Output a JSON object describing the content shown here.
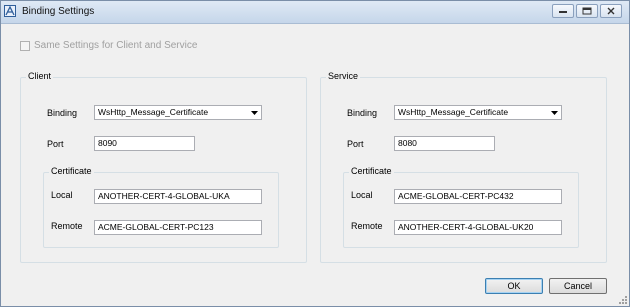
{
  "window": {
    "title": "Binding Settings"
  },
  "same_settings": {
    "label": "Same Settings for Client and Service",
    "checked": false,
    "enabled": false
  },
  "client": {
    "group_title": "Client",
    "binding_label": "Binding",
    "binding_value": "WsHttp_Message_Certificate",
    "port_label": "Port",
    "port_value": "8090",
    "certificate_title": "Certificate",
    "local_label": "Local",
    "local_value": "ANOTHER-CERT-4-GLOBAL-UKA",
    "remote_label": "Remote",
    "remote_value": "ACME-GLOBAL-CERT-PC123"
  },
  "service": {
    "group_title": "Service",
    "binding_label": "Binding",
    "binding_value": "WsHttp_Message_Certificate",
    "port_label": "Port",
    "port_value": "8080",
    "certificate_title": "Certificate",
    "local_label": "Local",
    "local_value": "ACME-GLOBAL-CERT-PC432",
    "remote_label": "Remote",
    "remote_value": "ANOTHER-CERT-4-GLOBAL-UK20"
  },
  "buttons": {
    "ok": "OK",
    "cancel": "Cancel"
  },
  "icons": {
    "app": "app-icon",
    "minimize": "minimize-icon",
    "maximize": "maximize-icon",
    "close": "close-icon"
  }
}
